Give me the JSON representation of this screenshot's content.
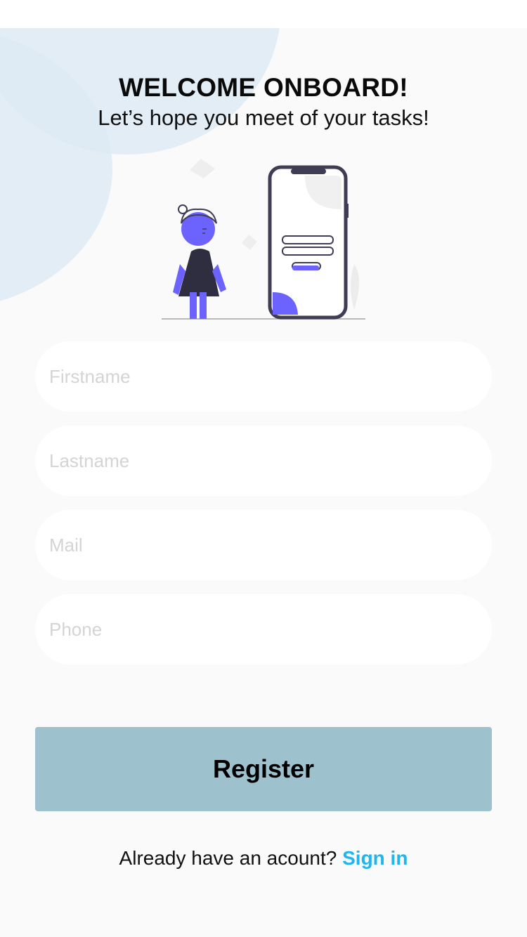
{
  "header": {
    "title": "WELCOME ONBOARD!",
    "subtitle": "Let’s hope you meet of your tasks!"
  },
  "form": {
    "firstname_placeholder": "Firstname",
    "lastname_placeholder": "Lastname",
    "mail_placeholder": "Mail",
    "phone_placeholder": "Phone",
    "firstname_value": "",
    "lastname_value": "",
    "mail_value": "",
    "phone_value": ""
  },
  "actions": {
    "register_label": "Register",
    "signin_prompt": "Already have an acount?",
    "signin_link": "Sign in"
  },
  "colors": {
    "accent_blob": "#ddeaf3",
    "register_button": "#9dc1cd",
    "link": "#1fb6f0",
    "illustration_accent": "#6c63ff"
  },
  "icons": {
    "illustration": "person-with-phone-illustration"
  }
}
